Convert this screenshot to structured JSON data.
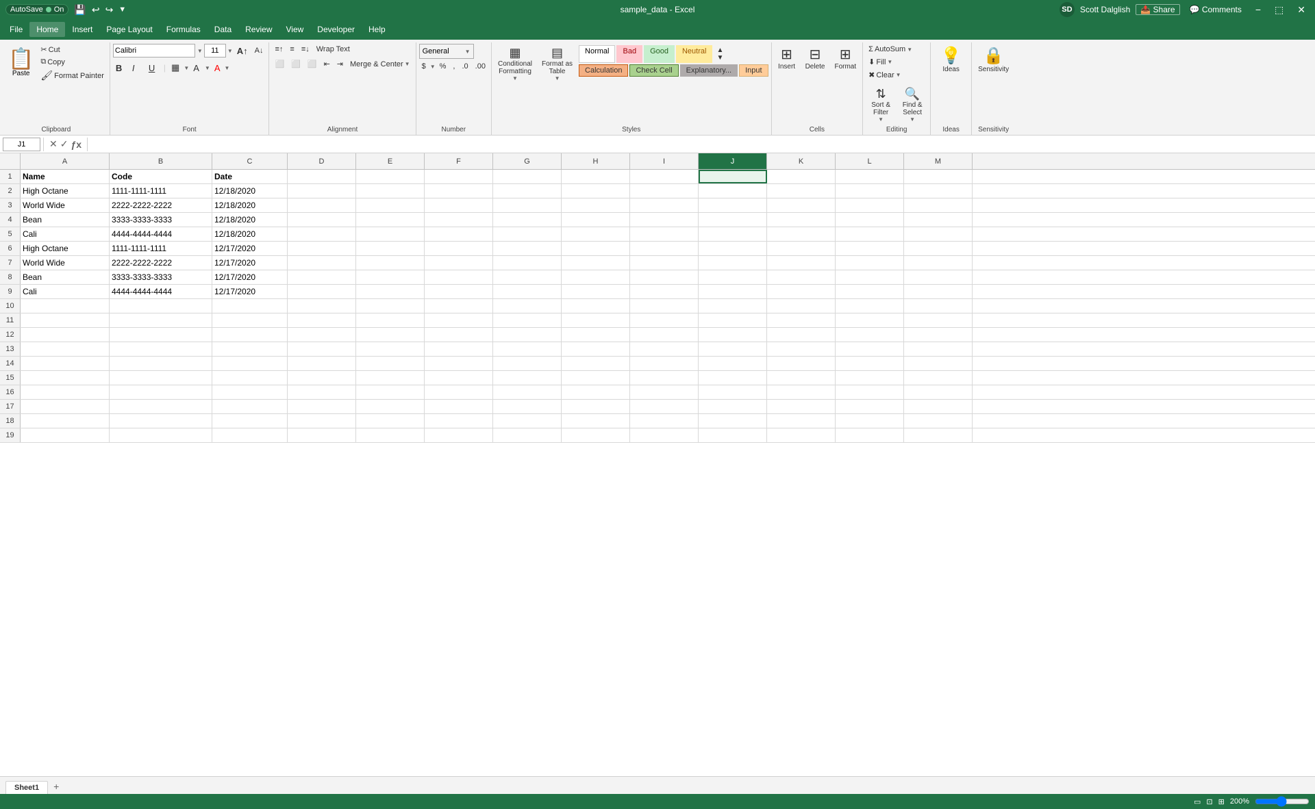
{
  "titlebar": {
    "autosave_label": "AutoSave",
    "autosave_on": "On",
    "title": "sample_data - Excel",
    "user": "Scott Dalglish",
    "user_initials": "SD"
  },
  "menubar": {
    "items": [
      "File",
      "Home",
      "Insert",
      "Page Layout",
      "Formulas",
      "Data",
      "Review",
      "View",
      "Developer",
      "Help"
    ]
  },
  "ribbon": {
    "clipboard": {
      "label": "Clipboard",
      "paste_label": "Paste",
      "cut_label": "Cut",
      "copy_label": "Copy",
      "format_painter_label": "Format Painter"
    },
    "font": {
      "label": "Font",
      "font_name": "Calibri",
      "font_size": "11"
    },
    "alignment": {
      "label": "Alignment",
      "wrap_text": "Wrap Text",
      "merge_center": "Merge & Center"
    },
    "number": {
      "label": "Number",
      "format": "General"
    },
    "styles": {
      "label": "Styles",
      "conditional_label": "Conditional\nFormatting",
      "format_table_label": "Format as\nTable",
      "normal_label": "Normal",
      "bad_label": "Bad",
      "good_label": "Good",
      "neutral_label": "Neutral",
      "calculation_label": "Calculation",
      "check_label": "Check Cell",
      "explanatory_label": "Explanatory...",
      "input_label": "Input"
    },
    "cells": {
      "label": "Cells",
      "insert_label": "Insert",
      "delete_label": "Delete",
      "format_label": "Format"
    },
    "editing": {
      "label": "Editing",
      "autosum_label": "AutoSum",
      "fill_label": "Fill",
      "clear_label": "Clear",
      "sort_filter_label": "Sort &\nFilter",
      "find_select_label": "Find &\nSelect"
    },
    "ideas": {
      "label": "Ideas",
      "ideas_btn_label": "Ideas"
    },
    "sensitivity": {
      "label": "Sensitivity",
      "sensitivity_btn_label": "Sensitivity"
    }
  },
  "formulabar": {
    "cell_ref": "J1",
    "formula": ""
  },
  "columns": [
    "A",
    "B",
    "C",
    "D",
    "E",
    "F",
    "G",
    "H",
    "I",
    "J",
    "K",
    "L",
    "M"
  ],
  "rows": [
    {
      "num": "1",
      "a": "Name",
      "b": "Code",
      "c": "Date",
      "d": "",
      "e": "",
      "f": "",
      "g": "",
      "h": "",
      "i": "",
      "j": "",
      "k": "",
      "l": "",
      "m": ""
    },
    {
      "num": "2",
      "a": "High Octane",
      "b": "1111-1111-1111",
      "c": "12/18/2020",
      "d": "",
      "e": "",
      "f": "",
      "g": "",
      "h": "",
      "i": "",
      "j": "",
      "k": "",
      "l": "",
      "m": ""
    },
    {
      "num": "3",
      "a": "World Wide",
      "b": "2222-2222-2222",
      "c": "12/18/2020",
      "d": "",
      "e": "",
      "f": "",
      "g": "",
      "h": "",
      "i": "",
      "j": "",
      "k": "",
      "l": "",
      "m": ""
    },
    {
      "num": "4",
      "a": "Bean",
      "b": "3333-3333-3333",
      "c": "12/18/2020",
      "d": "",
      "e": "",
      "f": "",
      "g": "",
      "h": "",
      "i": "",
      "j": "",
      "k": "",
      "l": "",
      "m": ""
    },
    {
      "num": "5",
      "a": "Cali",
      "b": "4444-4444-4444",
      "c": "12/18/2020",
      "d": "",
      "e": "",
      "f": "",
      "g": "",
      "h": "",
      "i": "",
      "j": "",
      "k": "",
      "l": "",
      "m": ""
    },
    {
      "num": "6",
      "a": "High Octane",
      "b": "1111-1111-1111",
      "c": "12/17/2020",
      "d": "",
      "e": "",
      "f": "",
      "g": "",
      "h": "",
      "i": "",
      "j": "",
      "k": "",
      "l": "",
      "m": ""
    },
    {
      "num": "7",
      "a": "World Wide",
      "b": "2222-2222-2222",
      "c": "12/17/2020",
      "d": "",
      "e": "",
      "f": "",
      "g": "",
      "h": "",
      "i": "",
      "j": "",
      "k": "",
      "l": "",
      "m": ""
    },
    {
      "num": "8",
      "a": "Bean",
      "b": "3333-3333-3333",
      "c": "12/17/2020",
      "d": "",
      "e": "",
      "f": "",
      "g": "",
      "h": "",
      "i": "",
      "j": "",
      "k": "",
      "l": "",
      "m": ""
    },
    {
      "num": "9",
      "a": "Cali",
      "b": "4444-4444-4444",
      "c": "12/17/2020",
      "d": "",
      "e": "",
      "f": "",
      "g": "",
      "h": "",
      "i": "",
      "j": "",
      "k": "",
      "l": "",
      "m": ""
    },
    {
      "num": "10",
      "a": "",
      "b": "",
      "c": "",
      "d": "",
      "e": "",
      "f": "",
      "g": "",
      "h": "",
      "i": "",
      "j": "",
      "k": "",
      "l": "",
      "m": ""
    },
    {
      "num": "11",
      "a": "",
      "b": "",
      "c": "",
      "d": "",
      "e": "",
      "f": "",
      "g": "",
      "h": "",
      "i": "",
      "j": "",
      "k": "",
      "l": "",
      "m": ""
    },
    {
      "num": "12",
      "a": "",
      "b": "",
      "c": "",
      "d": "",
      "e": "",
      "f": "",
      "g": "",
      "h": "",
      "i": "",
      "j": "",
      "k": "",
      "l": "",
      "m": ""
    },
    {
      "num": "13",
      "a": "",
      "b": "",
      "c": "",
      "d": "",
      "e": "",
      "f": "",
      "g": "",
      "h": "",
      "i": "",
      "j": "",
      "k": "",
      "l": "",
      "m": ""
    },
    {
      "num": "14",
      "a": "",
      "b": "",
      "c": "",
      "d": "",
      "e": "",
      "f": "",
      "g": "",
      "h": "",
      "i": "",
      "j": "",
      "k": "",
      "l": "",
      "m": ""
    },
    {
      "num": "15",
      "a": "",
      "b": "",
      "c": "",
      "d": "",
      "e": "",
      "f": "",
      "g": "",
      "h": "",
      "i": "",
      "j": "",
      "k": "",
      "l": "",
      "m": ""
    },
    {
      "num": "16",
      "a": "",
      "b": "",
      "c": "",
      "d": "",
      "e": "",
      "f": "",
      "g": "",
      "h": "",
      "i": "",
      "j": "",
      "k": "",
      "l": "",
      "m": ""
    },
    {
      "num": "17",
      "a": "",
      "b": "",
      "c": "",
      "d": "",
      "e": "",
      "f": "",
      "g": "",
      "h": "",
      "i": "",
      "j": "",
      "k": "",
      "l": "",
      "m": ""
    },
    {
      "num": "18",
      "a": "",
      "b": "",
      "c": "",
      "d": "",
      "e": "",
      "f": "",
      "g": "",
      "h": "",
      "i": "",
      "j": "",
      "k": "",
      "l": "",
      "m": ""
    },
    {
      "num": "19",
      "a": "",
      "b": "",
      "c": "",
      "d": "",
      "e": "",
      "f": "",
      "g": "",
      "h": "",
      "i": "",
      "j": "",
      "k": "",
      "l": "",
      "m": ""
    }
  ],
  "sheet_tabs": [
    "Sheet1"
  ],
  "statusbar": {
    "left": "",
    "zoom": "200%"
  },
  "selected_cell": "J1"
}
